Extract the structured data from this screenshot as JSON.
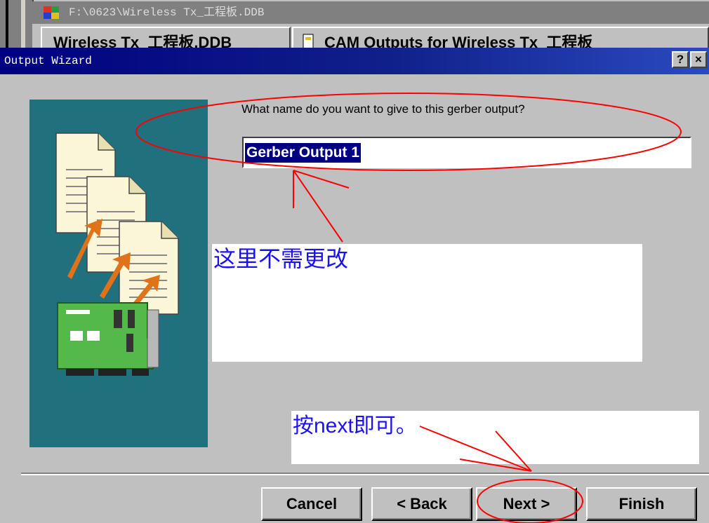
{
  "background_window": {
    "title": "F:\\0623\\Wireless Tx_工程板.DDB",
    "tab_1": "Wireless Tx_工程板.DDB",
    "tab_2": "CAM Outputs for Wireless Tx_工程板"
  },
  "dialog": {
    "title": "Output Wizard",
    "help_label": "?",
    "close_label": "×",
    "prompt": "What name do you want to give to this gerber output?",
    "name_value": "Gerber Output 1"
  },
  "annotations": {
    "note_1": "这里不需更改",
    "note_2": "按next即可。"
  },
  "buttons": {
    "cancel": "Cancel",
    "back": "< Back",
    "next": "Next >",
    "finish": "Finish"
  },
  "colors": {
    "title_bar": "#000080",
    "sidebar": "#21707e",
    "annotation_text": "#1a10ff",
    "annotation_ink": "#ff0000"
  }
}
